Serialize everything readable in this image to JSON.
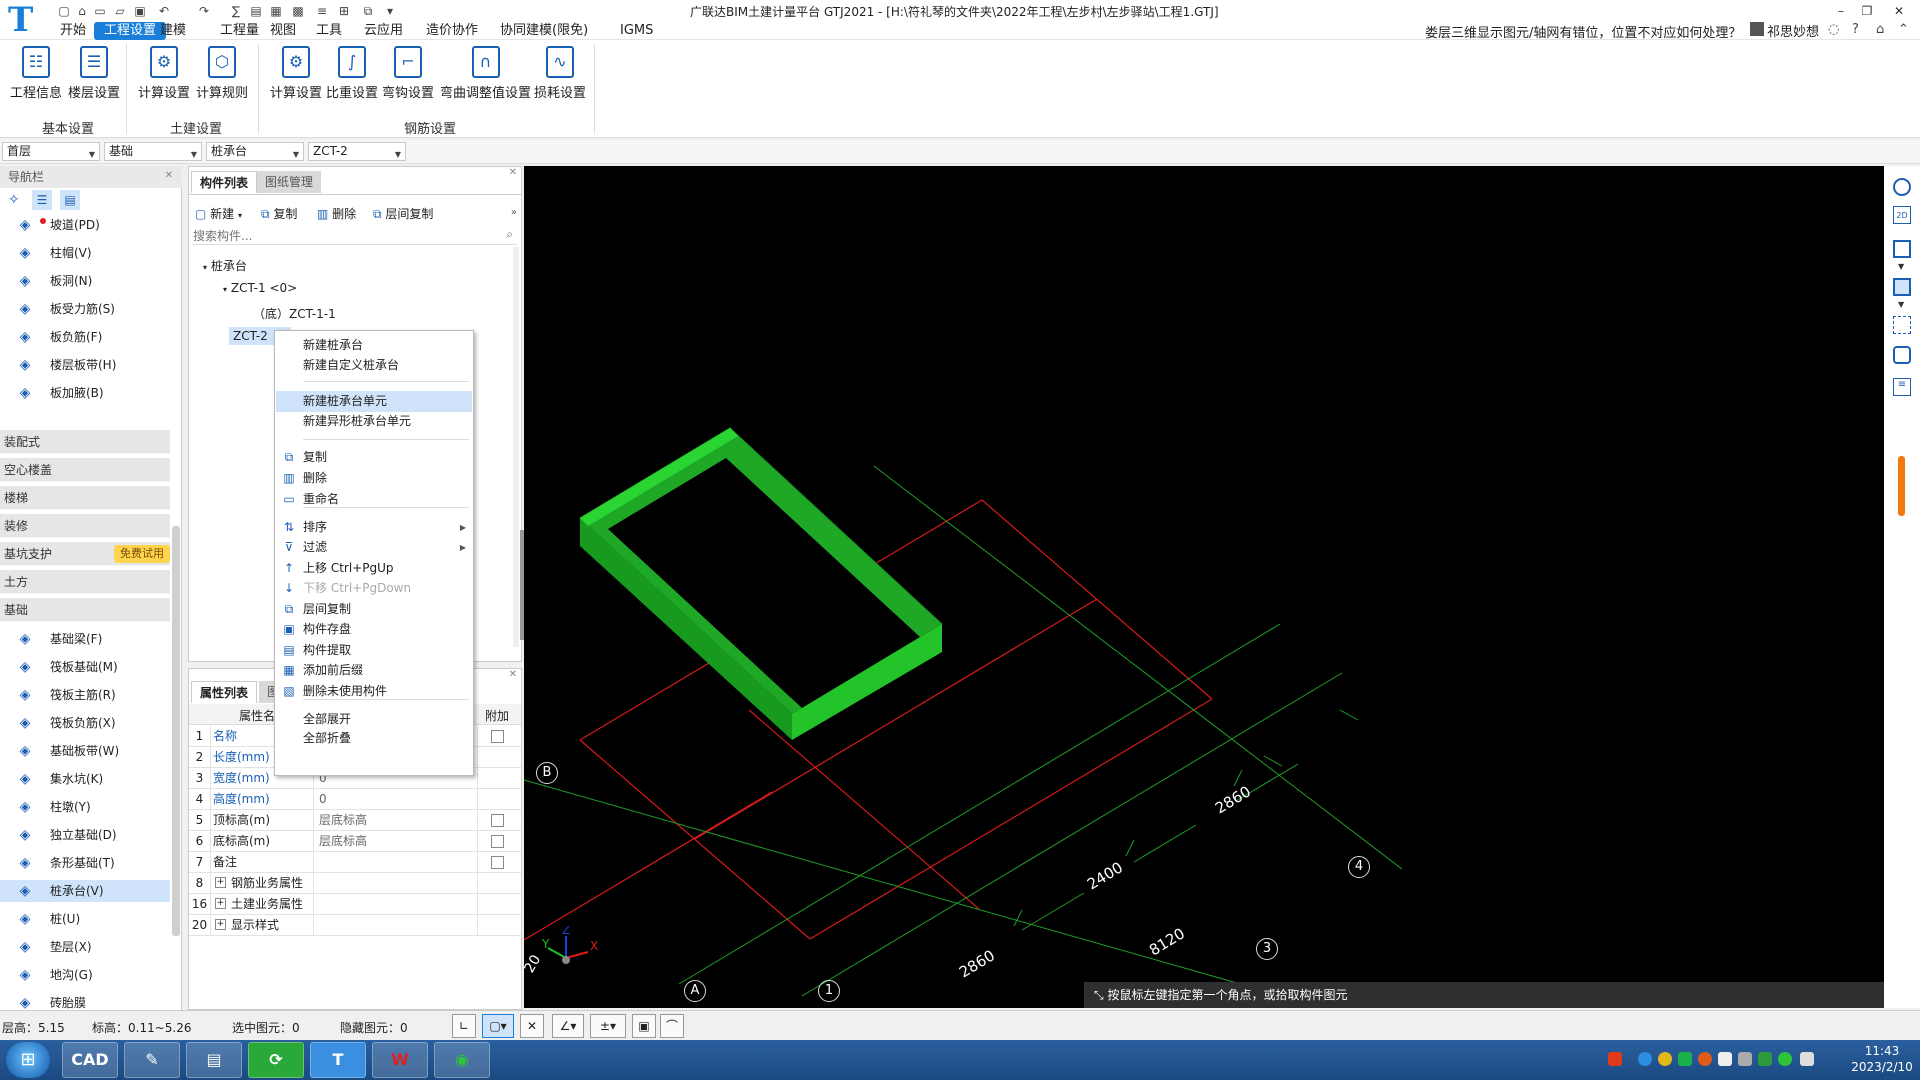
{
  "window": {
    "title": "广联达BIM土建计量平台 GTJ2021 - [H:\\符礼琴的文件夹\\2022年工程\\左步村\\左步驿站\\工程1.GTJ]",
    "help_question": "娄层三维显示图元/轴网有错位，位置不对应如何处理？",
    "user": "祁思妙想",
    "logo": "T"
  },
  "menu": [
    "开始",
    "工程设置",
    "建模",
    "工程量",
    "视图",
    "工具",
    "云应用",
    "造价协作",
    "协同建模(限免)",
    "IGMS"
  ],
  "menu_active": "工程设置",
  "ribbon": {
    "groups": [
      {
        "label": "基本设置",
        "buttons": [
          "工程信息",
          "楼层设置"
        ]
      },
      {
        "label": "土建设置",
        "buttons": [
          "计算设置",
          "计算规则"
        ]
      },
      {
        "label": "钢筋设置",
        "buttons": [
          "计算设置",
          "比重设置",
          "弯钩设置",
          "弯曲调整值设置",
          "损耗设置"
        ]
      }
    ]
  },
  "selectors": {
    "floor": "首层",
    "category": "基础",
    "type": "桩承台",
    "component": "ZCT-2"
  },
  "nav": {
    "title": "导航栏",
    "top_items": [
      {
        "label": "坡道(PD)",
        "icon": "ramp-icon"
      },
      {
        "label": "柱帽(V)",
        "icon": "column-cap-icon"
      },
      {
        "label": "板洞(N)",
        "icon": "slab-hole-icon"
      },
      {
        "label": "板受力筋(S)",
        "icon": "slab-rebar-icon"
      },
      {
        "label": "板负筋(F)",
        "icon": "slab-negative-rebar-icon"
      },
      {
        "label": "楼层板带(H)",
        "icon": "floor-strip-icon"
      },
      {
        "label": "板加腋(B)",
        "icon": "slab-haunch-icon"
      }
    ],
    "categories": [
      "装配式",
      "空心楼盖",
      "楼梯",
      "装修",
      "基坑支护",
      "土方",
      "基础"
    ],
    "trial_badge": "免费试用",
    "foundation_items": [
      {
        "label": "基础梁(F)",
        "icon": "foundation-beam-icon"
      },
      {
        "label": "筏板基础(M)",
        "icon": "raft-foundation-icon"
      },
      {
        "label": "筏板主筋(R)",
        "icon": "raft-main-rebar-icon"
      },
      {
        "label": "筏板负筋(X)",
        "icon": "raft-negative-rebar-icon"
      },
      {
        "label": "基础板带(W)",
        "icon": "foundation-strip-icon"
      },
      {
        "label": "集水坑(K)",
        "icon": "sump-pit-icon"
      },
      {
        "label": "柱墩(Y)",
        "icon": "column-pier-icon"
      },
      {
        "label": "独立基础(D)",
        "icon": "isolated-footing-icon"
      },
      {
        "label": "条形基础(T)",
        "icon": "strip-footing-icon"
      },
      {
        "label": "桩承台(V)",
        "icon": "pile-cap-icon"
      },
      {
        "label": "桩(U)",
        "icon": "pile-icon"
      },
      {
        "label": "垫层(X)",
        "icon": "cushion-icon"
      },
      {
        "label": "地沟(G)",
        "icon": "trench-icon"
      },
      {
        "label": "砖胎膜",
        "icon": "brick-mold-icon"
      }
    ],
    "selected": "桩承台(V)"
  },
  "component_panel": {
    "tabs": [
      "构件列表",
      "图纸管理"
    ],
    "toolbar": [
      "新建",
      "复制",
      "删除",
      "层间复制"
    ],
    "search_placeholder": "搜索构件...",
    "tree": {
      "root": "桩承台",
      "item1": "ZCT-1 <0>",
      "child1": "（底）ZCT-1-1",
      "item2": "ZCT-2"
    }
  },
  "context_menu": {
    "items": [
      "新建桩承台",
      "新建自定义桩承台",
      "新建桩承台单元",
      "新建异形桩承台单元",
      "复制",
      "删除",
      "重命名",
      "排序",
      "过滤",
      "上移 Ctrl+PgUp",
      "下移 Ctrl+PgDown",
      "层间复制",
      "构件存盘",
      "构件提取",
      "添加前后缀",
      "删除未使用构件",
      "全部展开",
      "全部折叠"
    ],
    "highlighted": "新建桩承台单元",
    "disabled": "下移 Ctrl+PgDown"
  },
  "property_panel": {
    "tabs": [
      "属性列表",
      "图"
    ],
    "headers": {
      "name": "属性名",
      "extra": "附加"
    },
    "rows": [
      {
        "n": "1",
        "k": "名称",
        "v": "",
        "blue": true,
        "cb": true
      },
      {
        "n": "2",
        "k": "长度(mm)",
        "v": "",
        "blue": true,
        "cb": false
      },
      {
        "n": "3",
        "k": "宽度(mm)",
        "v": "0",
        "blue": true,
        "cb": false
      },
      {
        "n": "4",
        "k": "高度(mm)",
        "v": "0",
        "blue": true,
        "cb": false
      },
      {
        "n": "5",
        "k": "顶标高(m)",
        "v": "层底标高",
        "blue": false,
        "cb": true
      },
      {
        "n": "6",
        "k": "底标高(m)",
        "v": "层底标高",
        "blue": false,
        "cb": true
      },
      {
        "n": "7",
        "k": "备注",
        "v": "",
        "blue": false,
        "cb": true
      },
      {
        "n": "8",
        "k": "钢筋业务属性",
        "v": "",
        "blue": false,
        "cb": false,
        "plus": true
      },
      {
        "n": "16",
        "k": "土建业务属性",
        "v": "",
        "blue": false,
        "cb": false,
        "plus": true
      },
      {
        "n": "20",
        "k": "显示样式",
        "v": "",
        "blue": false,
        "cb": false,
        "plus": true
      }
    ]
  },
  "viewport": {
    "axis_labels": [
      "B",
      "4",
      "3",
      "A",
      "1"
    ],
    "dimensions": [
      "2860",
      "2400",
      "8120",
      "2860"
    ],
    "hint": "按鼠标左键指定第一个角点，或拾取构件图元",
    "edge_text": "20"
  },
  "status": {
    "floor_height": "层高：5.15",
    "elevation": "标高：0.11~5.26",
    "selected": "选中图元：0",
    "hidden": "隐藏图元：0"
  },
  "taskbar": {
    "time": "11:43",
    "date": "2023/2/10"
  },
  "colors": {
    "accent": "#1a7fd8",
    "model_green": "#22c42a",
    "grid_red": "#d51a1a",
    "grid_green": "#1f9e2a"
  }
}
